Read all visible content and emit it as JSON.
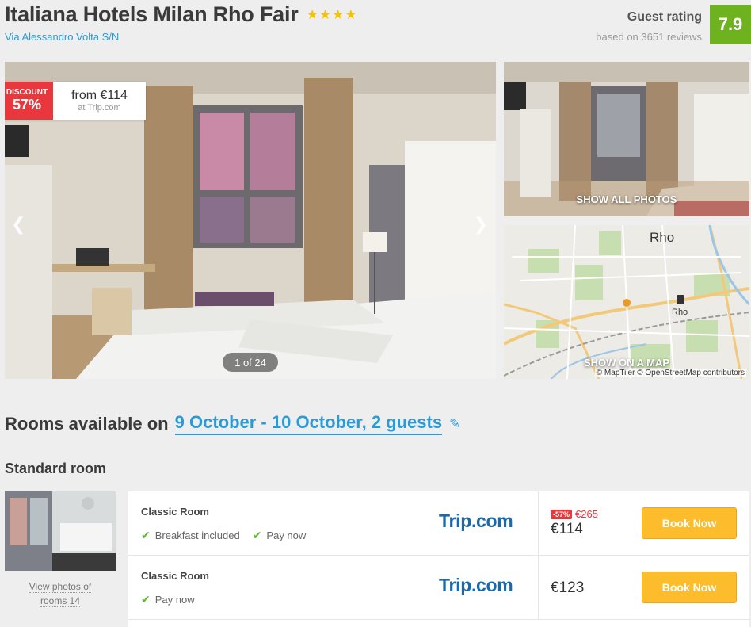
{
  "hotel": {
    "name": "Italiana Hotels Milan Rho Fair",
    "stars": "★★★★",
    "address": "Via Alessandro Volta S/N"
  },
  "rating": {
    "label": "Guest rating",
    "based_on": "based on 3651 reviews",
    "score": "7.9",
    "badge_color": "#6fb21f"
  },
  "gallery": {
    "discount_label": "DISCOUNT",
    "discount_pct": "57%",
    "from_price": "from €114",
    "source": "at Trip.com",
    "counter": "1 of 24",
    "prev_icon": "chevron-left-icon",
    "next_icon": "chevron-right-icon"
  },
  "side": {
    "show_photos": "SHOW ALL PHOTOS",
    "show_map": "SHOW ON A MAP",
    "map_city": "Rho",
    "map_station": "Rho",
    "map_attribution": "© MapTiler © OpenStreetMap contributors"
  },
  "rooms": {
    "heading_prefix": "Rooms available on",
    "dates": "9 October - 10 October, 2 guests",
    "edit_icon": "pencil-icon",
    "room_type": "Standard room",
    "view_photos_line1": "View photos of",
    "view_photos_line2": "rooms 14"
  },
  "offers": [
    {
      "name": "Classic Room",
      "features": [
        "Breakfast included",
        "Pay now"
      ],
      "provider": "Trip.com",
      "discount_badge": "-57%",
      "old_price": "€265",
      "price": "€114",
      "button": "Book Now"
    },
    {
      "name": "Classic Room",
      "features": [
        "Pay now"
      ],
      "provider": "Trip.com",
      "price": "€123",
      "button": "Book Now"
    }
  ],
  "colors": {
    "accent_blue": "#2a9bd6",
    "discount_red": "#e8383d",
    "book_yellow": "#fcbc2c",
    "check_green": "#5cb82c"
  }
}
